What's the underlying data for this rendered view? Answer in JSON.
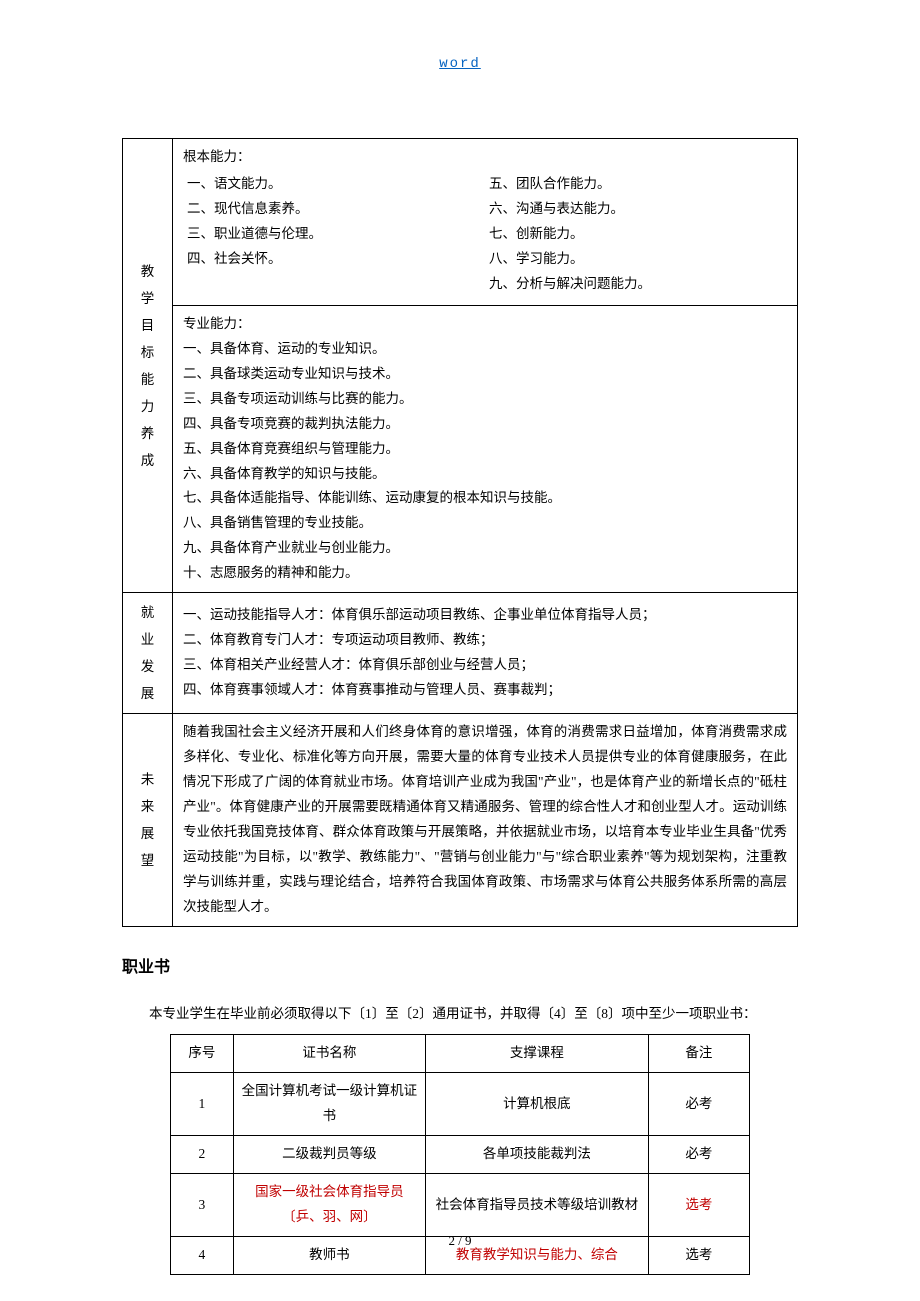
{
  "header_link": "word",
  "table1": {
    "rowlabel_a": "教学目标能力养成",
    "basic_title": "根本能力：",
    "basic_left": [
      "一、语文能力。",
      "二、现代信息素养。",
      "三、职业道德与伦理。",
      "四、社会关怀。"
    ],
    "basic_right": [
      "五、团队合作能力。",
      "六、沟通与表达能力。",
      "七、创新能力。",
      "八、学习能力。",
      "九、分析与解决问题能力。"
    ],
    "pro_title": "专业能力：",
    "pro": [
      "一、具备体育、运动的专业知识。",
      "二、具备球类运动专业知识与技术。",
      "三、具备专项运动训练与比赛的能力。",
      "四、具备专项竞赛的裁判执法能力。",
      "五、具备体育竞赛组织与管理能力。",
      "六、具备体育教学的知识与技能。",
      "七、具备体适能指导、体能训练、运动康复的根本知识与技能。",
      "八、具备销售管理的专业技能。",
      "九、具备体育产业就业与创业能力。",
      "十、志愿服务的精神和能力。"
    ],
    "rowlabel_b": "就业发展",
    "career": [
      "一、运动技能指导人才：体育俱乐部运动项目教练、企事业单位体育指导人员；",
      "二、体育教育专门人才：专项运动项目教师、教练；",
      "三、体育相关产业经营人才：体育俱乐部创业与经营人员；",
      "四、体育赛事领域人才：体育赛事推动与管理人员、赛事裁判；"
    ],
    "rowlabel_c": "未来展望",
    "future": "随着我国社会主义经济开展和人们终身体育的意识增强，体育的消费需求日益增加，体育消费需求成多样化、专业化、标准化等方向开展，需要大量的体育专业技术人员提供专业的体育健康服务，在此情况下形成了广阔的体育就业市场。体育培训产业成为我国\"产业\"，也是体育产业的新增长点的\"砥柱产业\"。体育健康产业的开展需要既精通体育又精通服务、管理的综合性人才和创业型人才。运动训练专业依托我国竞技体育、群众体育政策与开展策略，并依据就业市场，以培育本专业毕业生具备\"优秀运动技能\"为目标，以\"教学、教练能力\"、\"营销与创业能力\"与\"综合职业素养\"等为规划架构，注重教学与训练并重，实践与理论结合，培养符合我国体育政策、市场需求与体育公共服务体系所需的高层次技能型人才。"
  },
  "cert_section_title": "职业书",
  "cert_intro": "本专业学生在毕业前必须取得以下〔1〕至〔2〕通用证书，并取得〔4〕至〔8〕项中至少一项职业书：",
  "cert_headers": [
    "序号",
    "证书名称",
    "支撑课程",
    "备注"
  ],
  "cert_rows": [
    {
      "no": "1",
      "name": "全国计算机考试一级计算机证书",
      "name_red": false,
      "course": "计算机根底",
      "course_red": false,
      "note": "必考",
      "note_red": false
    },
    {
      "no": "2",
      "name": "二级裁判员等级",
      "name_red": false,
      "course": "各单项技能裁判法",
      "course_red": false,
      "note": "必考",
      "note_red": false
    },
    {
      "no": "3",
      "name": "国家一级社会体育指导员〔乒、羽、网〕",
      "name_red": true,
      "course": "社会体育指导员技术等级培训教材",
      "course_red": false,
      "note": "选考",
      "note_red": true
    },
    {
      "no": "4",
      "name": "教师书",
      "name_red": false,
      "course": "教育教学知识与能力、综合",
      "course_red": true,
      "note": "选考",
      "note_red": false
    }
  ],
  "footer": "2 / 9"
}
